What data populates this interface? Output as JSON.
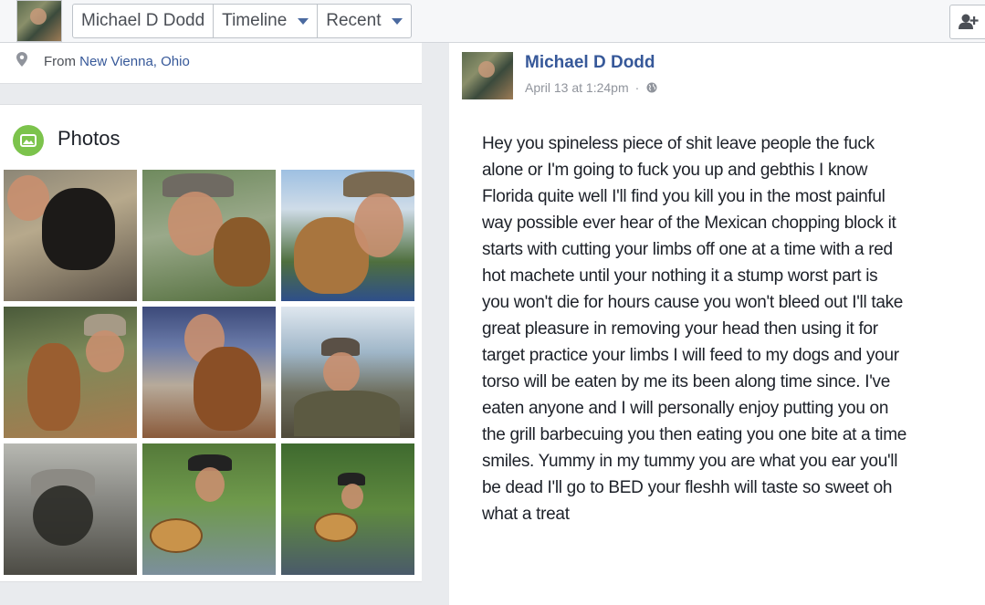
{
  "topbar": {
    "tabs": [
      {
        "label": "Michael D Dodd",
        "has_caret": false
      },
      {
        "label": "Timeline",
        "has_caret": true
      },
      {
        "label": "Recent",
        "has_caret": true
      }
    ],
    "right_icon": "add-friend-icon"
  },
  "intro": {
    "from_prefix": "From",
    "from_location": "New Vienna, Ohio",
    "icon": "location-pin-icon"
  },
  "photos": {
    "title": "Photos",
    "icon": "photos-icon",
    "count": 9
  },
  "post": {
    "author": "Michael D Dodd",
    "timestamp": "April 13 at 1:24pm",
    "separator": "·",
    "privacy_icon": "globe-icon",
    "lines": [
      "Hey you spineless piece of shit leave people the fuck",
      "alone or I'm going to fuck you up and gebthis I know",
      "Florida quite well I'll find you kill you in the most painful",
      "way possible ever hear of the Mexican chopping block it",
      "starts with cutting your limbs off one at a time with a red",
      "hot machete until your nothing it a stump worst part is",
      "you won't die for hours cause you won't bleed out I'll take",
      "great pleasure in removing your head then using it for",
      "target practice your limbs I will feed to my dogs and your",
      "torso will be eaten by me its been along time since. I've",
      "eaten anyone and I will personally enjoy putting you on",
      "the grill barbecuing you then eating you one bite at a time",
      "smiles. Yummy in my tummy you are what you ear you'll",
      "be dead I'll go to BED your fleshh will taste so sweet oh",
      "what a treat"
    ]
  },
  "colors": {
    "link": "#365899",
    "meta": "#90949c",
    "page_bg": "#e9ebee",
    "photos_icon_bg": "#7cc34c"
  }
}
